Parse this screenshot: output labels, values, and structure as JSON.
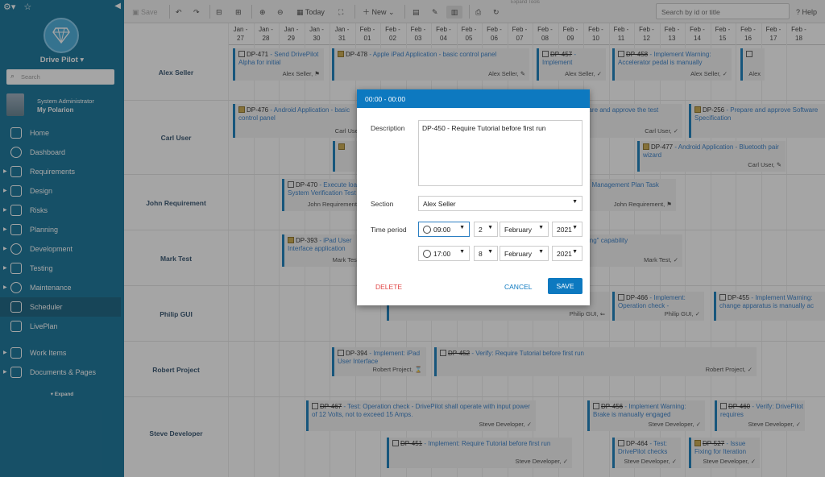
{
  "sidebar": {
    "project_name": "Drive Pilot",
    "search_placeholder": "Search",
    "user_role": "System Administrator",
    "user_project": "My Polarion",
    "nav": [
      {
        "label": "Home"
      },
      {
        "label": "Dashboard"
      },
      {
        "label": "Requirements"
      },
      {
        "label": "Design"
      },
      {
        "label": "Risks"
      },
      {
        "label": "Planning"
      },
      {
        "label": "Development"
      },
      {
        "label": "Testing"
      },
      {
        "label": "Maintenance"
      },
      {
        "label": "Scheduler"
      },
      {
        "label": "LivePlan"
      },
      {
        "label": "Work Items"
      },
      {
        "label": "Documents & Pages"
      }
    ],
    "expand_label": "Expand"
  },
  "toolbar": {
    "save": "Save",
    "today": "Today",
    "new": "New",
    "expand_tools": "Expand Tools",
    "search_placeholder": "Search by id or title",
    "help": "Help"
  },
  "scheduler": {
    "days": [
      {
        "m": "Jan -",
        "d": "27"
      },
      {
        "m": "Jan -",
        "d": "28"
      },
      {
        "m": "Jan -",
        "d": "29"
      },
      {
        "m": "Jan -",
        "d": "30"
      },
      {
        "m": "Jan -",
        "d": "31"
      },
      {
        "m": "Feb -",
        "d": "01"
      },
      {
        "m": "Feb -",
        "d": "02"
      },
      {
        "m": "Feb -",
        "d": "03"
      },
      {
        "m": "Feb -",
        "d": "04"
      },
      {
        "m": "Feb -",
        "d": "05"
      },
      {
        "m": "Feb -",
        "d": "06"
      },
      {
        "m": "Feb -",
        "d": "07"
      },
      {
        "m": "Feb -",
        "d": "08"
      },
      {
        "m": "Feb -",
        "d": "09"
      },
      {
        "m": "Feb -",
        "d": "10"
      },
      {
        "m": "Feb -",
        "d": "11"
      },
      {
        "m": "Feb -",
        "d": "12"
      },
      {
        "m": "Feb -",
        "d": "13"
      },
      {
        "m": "Feb -",
        "d": "14"
      },
      {
        "m": "Feb -",
        "d": "15"
      },
      {
        "m": "Feb -",
        "d": "16"
      },
      {
        "m": "Feb -",
        "d": "17"
      },
      {
        "m": "Feb -",
        "d": "18"
      }
    ],
    "sections": [
      "Alex Seller",
      "Carl User",
      "John Requirement",
      "Mark Test",
      "Philip GUI",
      "Robert Project",
      "Steve Developer"
    ],
    "events": {
      "e471": {
        "id": "DP-471",
        "title": "Send DrivePilot Alpha for initial",
        "assignee": "Alex Seller,"
      },
      "e478": {
        "id": "DP-478",
        "title": "Apple iPad Application - basic control panel",
        "assignee": "Alex Seller,"
      },
      "e457": {
        "id": "DP-457",
        "title": "Implement",
        "assignee": "Alex Seller,"
      },
      "e458": {
        "id": "DP-458",
        "title": "Implement Warning: Accelerator pedal is manually",
        "assignee": "Alex Seller,"
      },
      "e476": {
        "id": "DP-476",
        "title": "Android Application - basic control panel",
        "assignee": "Carl User,"
      },
      "e476b": {
        "title": "pare and approve the test",
        "assignee": "Carl User,"
      },
      "e256": {
        "id": "DP-256",
        "title": "Prepare and approve Software Specification"
      },
      "e477": {
        "id": "DP-477",
        "title": "Android Application - Bluetooth pair wizard",
        "assignee": "Carl User,"
      },
      "e470": {
        "id": "DP-470",
        "title": "Execute load System Verification Test",
        "assignee": "John Requirement,"
      },
      "e470b": {
        "title": "ct Management Plan Task",
        "assignee": "John Requirement,"
      },
      "e393": {
        "id": "DP-393",
        "title": "iPad User Interface application",
        "assignee": "Mark Test"
      },
      "e393b": {
        "title": "king\" capability",
        "assignee": "Mark Test,"
      },
      "e466": {
        "id": "DP-466",
        "title": "Implement: Operation check -",
        "assignee": "Philip GUI,"
      },
      "e455": {
        "id": "DP-455",
        "title": "Implement Warning: change apparatus is manually ac"
      },
      "ePhil": {
        "assignee": "Philip GUI,"
      },
      "e394": {
        "id": "DP-394",
        "title": "Implement: iPad User Interface",
        "assignee": "Robert Project,"
      },
      "e452": {
        "id": "DP-452",
        "title": "Verify: Require Tutorial before first run",
        "assignee": "Robert Project,"
      },
      "e467": {
        "id": "DP-467",
        "title": "Test: Operation check - DrivePilot shall operate with input power of 12 Volts, not to exceed 15 Amps.",
        "assignee": "Steve Developer,"
      },
      "e456": {
        "id": "DP-456",
        "title": "Implement Warning: Brake is manually engaged",
        "assignee": "Steve Developer,"
      },
      "e460": {
        "id": "DP-460",
        "title": "Verify: DrivePilot requires",
        "assignee": "Steve Developer,"
      },
      "e451": {
        "id": "DP-451",
        "title": "Implement: Require Tutorial before first run",
        "assignee": "Steve Developer,"
      },
      "e464": {
        "id": "DP-464",
        "title": "Test: DrivePilot checks",
        "assignee": "Steve Developer,"
      },
      "e527": {
        "id": "DP-527",
        "title": "Issue Fixing for Iteration",
        "assignee": "Steve Developer,"
      },
      "eAlex": {
        "assignee": "Alex"
      }
    }
  },
  "dialog": {
    "header": "00:00 - 00:00",
    "description_label": "Description",
    "description_value": "DP-450 - Require Tutorial before first run",
    "section_label": "Section",
    "section_value": "Alex Seller",
    "time_label": "Time period",
    "start": {
      "time": "09:00",
      "day": "2",
      "month": "February",
      "year": "2021"
    },
    "end": {
      "time": "17:00",
      "day": "8",
      "month": "February",
      "year": "2021"
    },
    "delete": "DELETE",
    "cancel": "CANCEL",
    "save": "SAVE"
  }
}
